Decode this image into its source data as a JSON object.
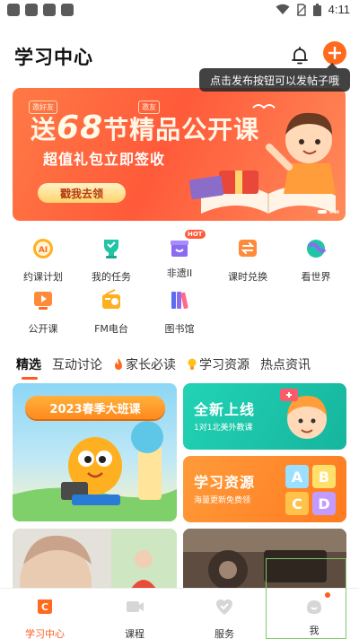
{
  "status_bar": {
    "time": "4:11"
  },
  "header": {
    "title": "学习中心"
  },
  "tooltip": {
    "text": "点击发布按钮可以发帖子哦"
  },
  "banner": {
    "tag_left": "邀好友",
    "tag_right": "邀友",
    "headline_prefix": "送",
    "headline_number": "68",
    "headline_suffix": "节精品公开课",
    "subline": "超值礼包立即签收",
    "button_label": "戳我去领"
  },
  "grid": {
    "items": [
      {
        "label": "约课计划",
        "icon": "ai-clock-icon"
      },
      {
        "label": "我的任务",
        "icon": "trophy-icon"
      },
      {
        "label": "非遗II",
        "icon": "gift-box-icon",
        "badge": "HOT"
      },
      {
        "label": "课时兑换",
        "icon": "exchange-icon"
      },
      {
        "label": "看世界",
        "icon": "globe-icon"
      },
      {
        "label": "公开课",
        "icon": "video-icon"
      },
      {
        "label": "FM电台",
        "icon": "radio-icon"
      },
      {
        "label": "图书馆",
        "icon": "books-icon"
      }
    ]
  },
  "tabs": [
    {
      "label": "精选",
      "active": true
    },
    {
      "label": "互动讨论"
    },
    {
      "label": "家长必读",
      "icon": "flame-icon"
    },
    {
      "label": "学习资源",
      "icon": "bulb-icon"
    },
    {
      "label": "热点资讯"
    }
  ],
  "cards": {
    "big_title": "2023春季大班课",
    "top_right_title": "全新上线",
    "top_right_sub": "1对1北美外教课",
    "bottom_right_title": "学习资源",
    "bottom_right_sub": "海量更新免费领"
  },
  "bottom_nav": [
    {
      "label": "学习中心",
      "active": true
    },
    {
      "label": "课程"
    },
    {
      "label": "服务"
    },
    {
      "label": "我",
      "dot": true
    }
  ],
  "colors": {
    "accent": "#ff5a1f",
    "teal": "#22d3b4",
    "orange": "#ff8a1e"
  }
}
